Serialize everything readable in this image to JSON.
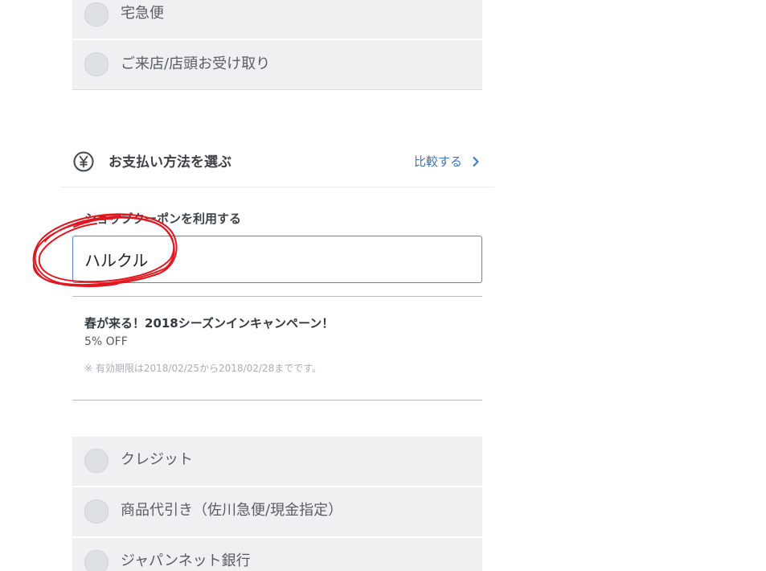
{
  "shipping": {
    "options": [
      {
        "label": "宅急便"
      },
      {
        "label": "ご来店/店頭お受け取り"
      }
    ]
  },
  "payment": {
    "title": "お支払い方法を選ぶ",
    "title_icon": "yen-icon",
    "compare_label": "比較する",
    "compare_icon": "chevron-right-icon",
    "coupon": {
      "label": "ショップクーポンを利用する",
      "value": "ハルクル"
    },
    "campaign": {
      "title": "春が来る！2018シーズンインキャンペーン！",
      "discount": "5% OFF",
      "validity": "※ 有効期限は2018/02/25から2018/02/28までです。"
    },
    "options": [
      {
        "label": "クレジット"
      },
      {
        "label": "商品代引き（佐川急便/現金指定）"
      },
      {
        "label": "ジャパンネット銀行"
      }
    ]
  },
  "theme": {
    "accent": "#3a72c6",
    "text": "#3d4246",
    "option_background": "#eef0f2",
    "annotation": "#e3151f"
  }
}
